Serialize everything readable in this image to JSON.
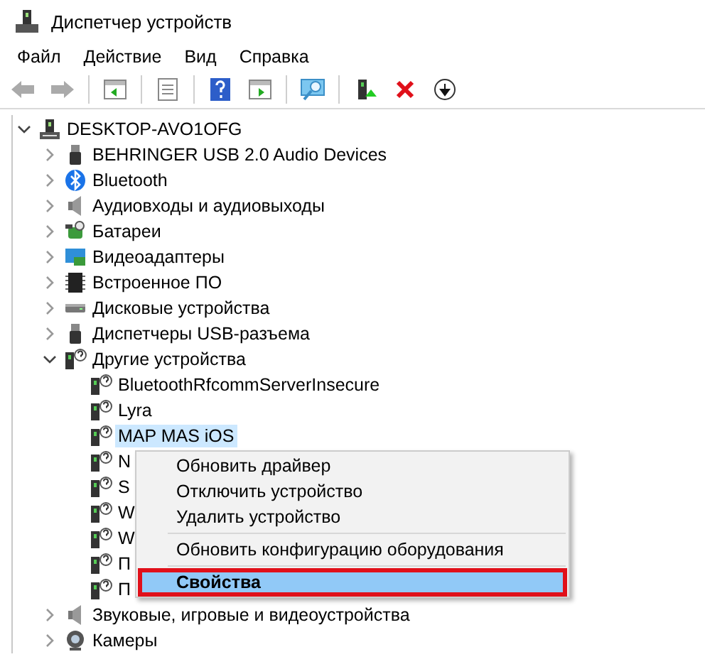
{
  "window": {
    "title": "Диспетчер устройств"
  },
  "menu": [
    {
      "label": "Файл"
    },
    {
      "label": "Действие"
    },
    {
      "label": "Вид"
    },
    {
      "label": "Справка"
    }
  ],
  "tree": {
    "label": "DESKTOP-AVO1OFG",
    "kind": "computer",
    "expanded": true,
    "selected": false,
    "children": [
      {
        "label": "BEHRINGER USB 2.0 Audio Devices",
        "kind": "usb",
        "expanded": false,
        "selected": false
      },
      {
        "label": "Bluetooth",
        "kind": "bluetooth",
        "expanded": false,
        "selected": false
      },
      {
        "label": "Аудиовходы и аудиовыходы",
        "kind": "speaker",
        "expanded": false,
        "selected": false
      },
      {
        "label": "Батареи",
        "kind": "battery",
        "expanded": false,
        "selected": false
      },
      {
        "label": "Видеоадаптеры",
        "kind": "display",
        "expanded": false,
        "selected": false
      },
      {
        "label": "Встроенное ПО",
        "kind": "chip",
        "expanded": false,
        "selected": false
      },
      {
        "label": "Дисковые устройства",
        "kind": "disk",
        "expanded": false,
        "selected": false
      },
      {
        "label": "Диспетчеры USB-разъема",
        "kind": "usb",
        "expanded": false,
        "selected": false
      },
      {
        "label": "Другие устройства",
        "kind": "unknown",
        "expanded": true,
        "selected": false,
        "children": [
          {
            "label": "BluetoothRfcommServerInsecure",
            "kind": "unknown",
            "selected": false
          },
          {
            "label": "Lyra",
            "kind": "unknown",
            "selected": false
          },
          {
            "label": "MAP MAS iOS",
            "kind": "unknown",
            "selected": true
          },
          {
            "label": "N",
            "kind": "unknown",
            "selected": false
          },
          {
            "label": "S",
            "kind": "unknown",
            "selected": false
          },
          {
            "label": "W",
            "kind": "unknown",
            "selected": false
          },
          {
            "label": "W",
            "kind": "unknown",
            "selected": false
          },
          {
            "label": "П",
            "kind": "unknown",
            "selected": false
          },
          {
            "label": "П",
            "kind": "unknown",
            "selected": false
          }
        ]
      },
      {
        "label": "Звуковые, игровые и видеоустройства",
        "kind": "speaker",
        "expanded": false,
        "selected": false
      },
      {
        "label": "Камеры",
        "kind": "camera",
        "expanded": false,
        "selected": false
      }
    ]
  },
  "context_menu": {
    "items": [
      {
        "kind": "item",
        "label": "Обновить драйвер",
        "selected": false,
        "bold": false
      },
      {
        "kind": "item",
        "label": "Отключить устройство",
        "selected": false,
        "bold": false
      },
      {
        "kind": "item",
        "label": "Удалить устройство",
        "selected": false,
        "bold": false
      },
      {
        "kind": "separator"
      },
      {
        "kind": "item",
        "label": "Обновить конфигурацию оборудования",
        "selected": false,
        "bold": false
      },
      {
        "kind": "separator"
      },
      {
        "kind": "item",
        "label": "Свойства",
        "selected": true,
        "bold": true
      }
    ]
  }
}
